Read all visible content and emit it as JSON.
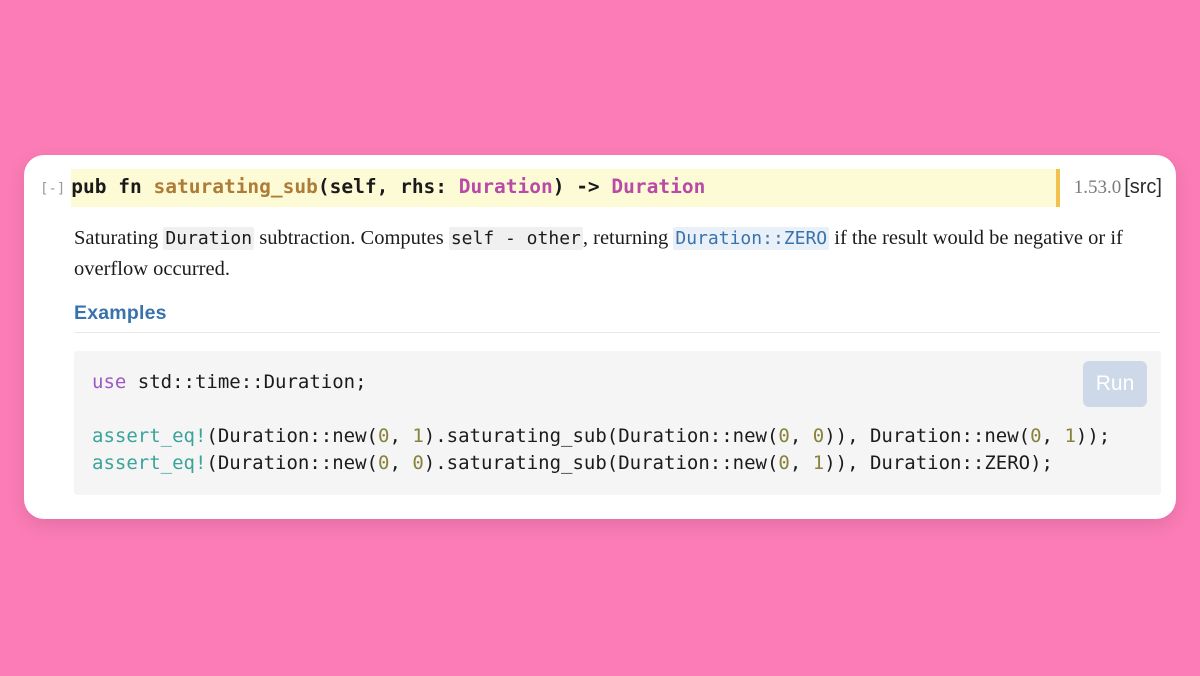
{
  "background_color": "#fb7cb6",
  "card": {
    "background_color": "#ffffff",
    "toggle_label": "[-]",
    "signature": {
      "background_color": "#fdfbd6",
      "accent_bar_color": "#f2c14e",
      "keyword_pub": "pub",
      "keyword_fn": "fn",
      "fn_name": "saturating_sub",
      "paren_open": "(",
      "params": "self, rhs: ",
      "param_type": "Duration",
      "paren_close": ")",
      "arrow": " -> ",
      "return_type": "Duration",
      "fn_name_color": "#ad7c37",
      "type_color": "#b94ba7"
    },
    "version": "1.53.0",
    "src_link": "[src]",
    "description": {
      "part1": "Saturating ",
      "code1": "Duration",
      "part2": " subtraction. Computes ",
      "code2": "self - other",
      "part3": ", returning ",
      "link1": "Duration::ZERO",
      "link1_color": "#3873ad",
      "part4": " if the result would be negative or if overflow occurred."
    },
    "examples_heading": "Examples",
    "examples_heading_color": "#3873ad",
    "code_block": {
      "background_color": "#f5f5f5",
      "line1_kw": "use",
      "line1_rest": " std::time::Duration;",
      "line3_macro": "assert_eq!",
      "line3_a": "(Duration::new(",
      "line3_n1": "0",
      "line3_b": ", ",
      "line3_n2": "1",
      "line3_c": ").saturating_sub(Duration::new(",
      "line3_n3": "0",
      "line3_d": ", ",
      "line3_n4": "0",
      "line3_e": ")), Duration::new(",
      "line3_n5": "0",
      "line3_f": ", ",
      "line3_n6": "1",
      "line3_g": "));",
      "line4_macro": "assert_eq!",
      "line4_a": "(Duration::new(",
      "line4_n1": "0",
      "line4_b": ", ",
      "line4_n2": "0",
      "line4_c": ").saturating_sub(Duration::new(",
      "line4_n3": "0",
      "line4_d": ", ",
      "line4_n4": "1",
      "line4_e": ")), Duration::ZERO);",
      "macro_color": "#3aa39a",
      "number_color": "#87833b",
      "keyword_color": "#9b59c4"
    },
    "run_button_label": "Run",
    "run_button_color": "#cdd9e8"
  }
}
